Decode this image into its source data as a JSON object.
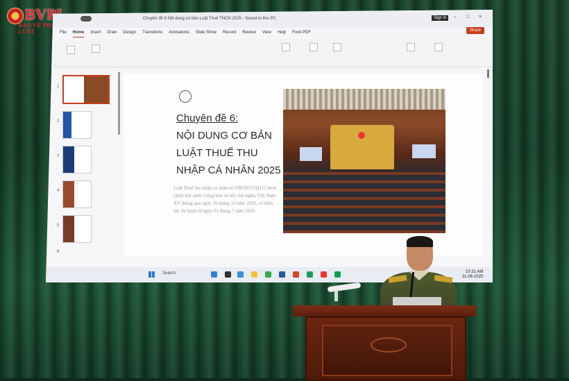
{
  "watermark": {
    "brand": "BVPL",
    "tagline": "BẢO VỆ PHÁP LUẬT"
  },
  "app": {
    "doc_title": "Chuyên đề 6 Nội dung cơ bản Luật Thuế TNCN 2025 - Saved to this PC",
    "signin_label": "Sign in",
    "share_label": "Share",
    "tabs": [
      "File",
      "Home",
      "Insert",
      "Draw",
      "Design",
      "Transitions",
      "Animations",
      "Slide Show",
      "Record",
      "Review",
      "View",
      "Help",
      "Foxit PDF"
    ],
    "active_tab": "Home"
  },
  "thumbnails": [
    "1",
    "2",
    "3",
    "4",
    "5",
    "6"
  ],
  "slide": {
    "title_line1": "Chuyên đề 6:",
    "title_line2": "NỘI DUNG CƠ BẢN",
    "title_line3": "LUẬT THUẾ THU",
    "title_line4": "NHẬP CÁ NHÂN 2025",
    "body": "Luật Thuế thu nhập cá nhân số 109/2025/QH15 được Quốc hội nước Cộng hoà xã hội chủ nghĩa Việt Nam XV thông qua ngày 10 tháng 12 năm 2025, có hiệu lực thi hành từ ngày 01 tháng 7 năm 2026."
  },
  "taskbar": {
    "search_label": "Search",
    "time": "10:31 AM",
    "date": "11-06-2025"
  },
  "colors": {
    "accent": "#c43e1c",
    "curtain": "#1b4a30",
    "podium": "#6b2612",
    "brand_red": "#e7242b"
  }
}
